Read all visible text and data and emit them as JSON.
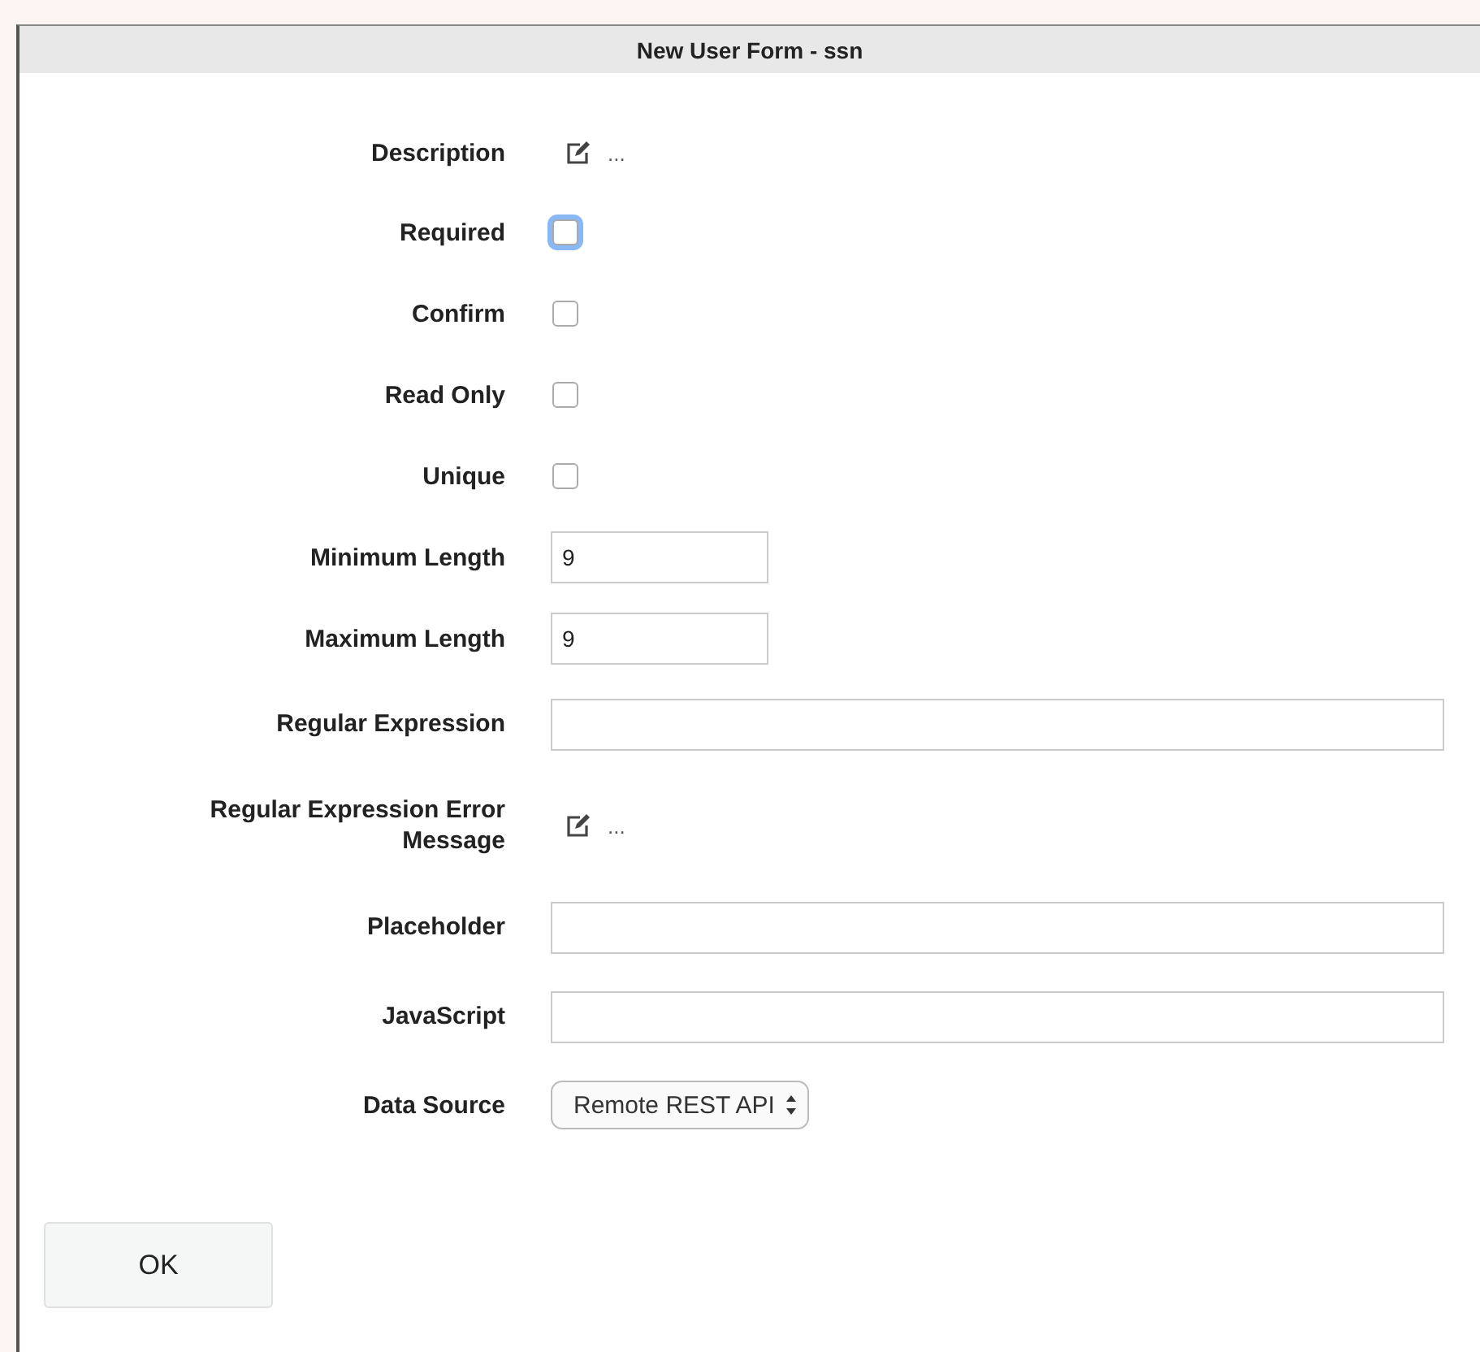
{
  "dialog": {
    "title": "New User Form - ssn"
  },
  "fields": [
    {
      "label": "Description",
      "kind": "edit",
      "text": "..."
    },
    {
      "label": "Required",
      "kind": "checkbox",
      "checked": false,
      "focused": true
    },
    {
      "label": "Confirm",
      "kind": "checkbox",
      "checked": false,
      "focused": false
    },
    {
      "label": "Read Only",
      "kind": "checkbox",
      "checked": false,
      "focused": false
    },
    {
      "label": "Unique",
      "kind": "checkbox",
      "checked": false,
      "focused": false
    },
    {
      "label": "Minimum Length",
      "kind": "short-text",
      "value": "9"
    },
    {
      "label": "Maximum Length",
      "kind": "short-text",
      "value": "9"
    },
    {
      "label": "Regular Expression",
      "kind": "text"
    },
    {
      "label": "Regular Expression Error Message",
      "kind": "edit",
      "text": "..."
    },
    {
      "label": "Placeholder",
      "kind": "text"
    },
    {
      "label": "JavaScript",
      "kind": "text"
    },
    {
      "label": "Data Source",
      "kind": "select",
      "value": "Remote REST API"
    }
  ],
  "buttons": [
    {
      "label": "OK"
    }
  ]
}
